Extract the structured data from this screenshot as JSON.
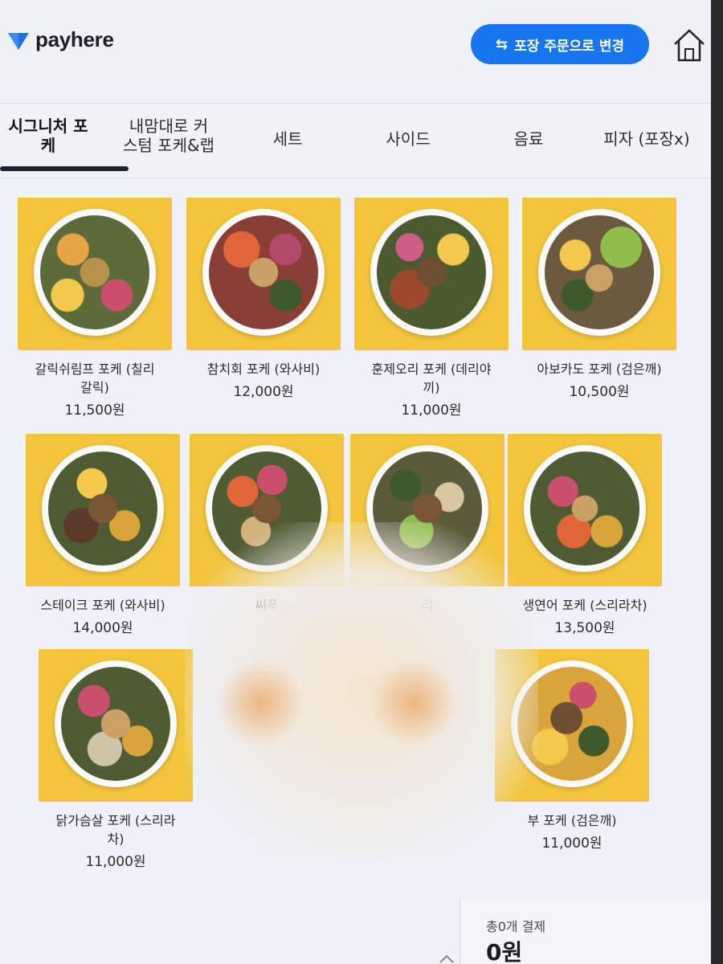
{
  "header": {
    "logo_text": "payhere",
    "togo_button_label": "포장 주문으로 변경",
    "brand_color": "#1775ee"
  },
  "tabs": [
    {
      "label": "시그니처 포\n케",
      "active": true
    },
    {
      "label": "내맘대로 커\n스텀 포케&랩",
      "active": false
    },
    {
      "label": "세트",
      "active": false
    },
    {
      "label": "사이드",
      "active": false
    },
    {
      "label": "음료",
      "active": false
    },
    {
      "label": "피자 (포장x)",
      "active": false
    }
  ],
  "menu": [
    {
      "name": "갈릭쉬림프 포케 (칠리\n갈릭)",
      "price": "11,500원"
    },
    {
      "name": "참치회 포케 (와사비)",
      "price": "12,000원"
    },
    {
      "name": "훈제오리 포케 (데리야\n끼)",
      "price": "11,000원"
    },
    {
      "name": "아보카도 포케 (검은깨)",
      "price": "10,500원"
    },
    {
      "name": "스테이크 포케 (와사비)",
      "price": "14,000원"
    },
    {
      "name": "씨푸",
      "price": ""
    },
    {
      "name": "리",
      "price": ""
    },
    {
      "name": "생연어 포케 (스리라차)",
      "price": "13,500원"
    },
    {
      "name": "닭가슴살 포케 (스리라\n차)",
      "price": "11,000원"
    },
    {
      "name": "",
      "price": ""
    },
    {
      "name": "",
      "price": ""
    },
    {
      "name": "부 포케 (검은깨)",
      "price": "11,000원"
    }
  ],
  "checkout": {
    "total_label": "총0개 결제",
    "total_amount": "0원"
  },
  "icons": {
    "logo": "payhere-logo-icon",
    "swap": "swap-arrows-icon",
    "home": "home-icon",
    "scroll": "chevron-up-icon"
  }
}
